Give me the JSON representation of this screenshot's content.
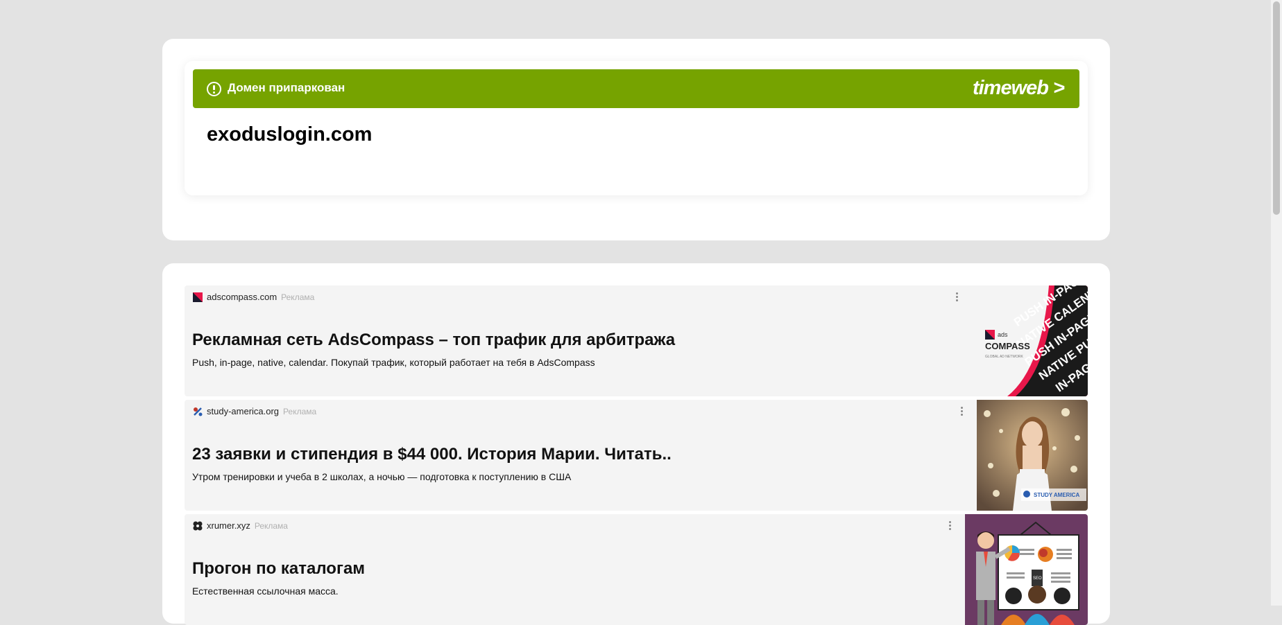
{
  "parking": {
    "status_text": "Домен припаркован",
    "brand_logo": "timeweb >",
    "domain": "exoduslogin.com"
  },
  "ads": [
    {
      "source": "adscompass.com",
      "label": "Реклама",
      "title": "Рекламная сеть AdsCompass – топ трафик для арбитража",
      "description": "Push, in-page, native, calendar. Покупай трафик, который работает на тебя в AdsCompass",
      "image_logo_top": "ads",
      "image_logo_main": "COMPASS",
      "image_logo_sub": "GLOBAL AD NETWORK",
      "image_words": "PUSH IN-PAGE NATIVE CALENDAR"
    },
    {
      "source": "study-america.org",
      "label": "Реклама",
      "title": "23 заявки и стипендия в $44 000. История Марии. Читать..",
      "description": "Утром тренировки и учеба в 2 школах, а ночью — подготовка к поступлению в США",
      "image_logo": "STUDY AMERICA"
    },
    {
      "source": "xrumer.xyz",
      "label": "Реклама",
      "title": "Прогон по каталогам",
      "description": "Естественная ссылочная масса.",
      "image_board_text": "SEO"
    }
  ],
  "colors": {
    "banner": "#76a300",
    "page_bg": "#e3e3e3",
    "ad_bg": "#f4f4f4"
  }
}
